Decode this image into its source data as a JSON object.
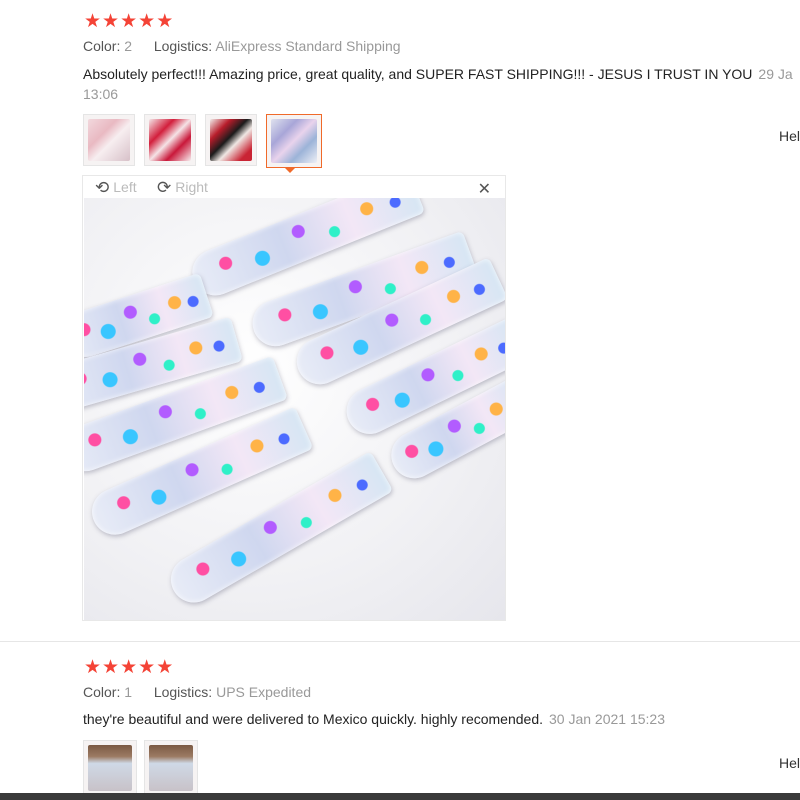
{
  "reviews": [
    {
      "stars": [
        "★",
        "★",
        "★",
        "★",
        "★"
      ],
      "color_label": "Color:",
      "color_value": "2",
      "logistics_label": "Logistics:",
      "logistics_value": "AliExpress Standard Shipping",
      "text": "Absolutely perfect!!! Amazing price, great quality, and SUPER FAST SHIPPING!!! - JESUS I TRUST IN YOU",
      "date": "29 Ja",
      "time": "13:06",
      "helpful": "Hel"
    },
    {
      "stars": [
        "★",
        "★",
        "★",
        "★",
        "★"
      ],
      "color_label": "Color:",
      "color_value": "1",
      "logistics_label": "Logistics:",
      "logistics_value": "UPS Expedited",
      "text": "they're beautiful and were delivered to Mexico quickly. highly recomended.",
      "date": "30 Jan 2021 15:23",
      "helpful": "Hel"
    }
  ],
  "viewer": {
    "rotate_left": "Left",
    "rotate_right": "Right",
    "rotate_left_icon": "rotate-left-icon",
    "rotate_right_icon": "rotate-right-icon",
    "close_icon": "close-icon"
  },
  "colors": {
    "star": "#f44336",
    "active_thumb_border": "#f06a2a",
    "muted_text": "#999999"
  }
}
